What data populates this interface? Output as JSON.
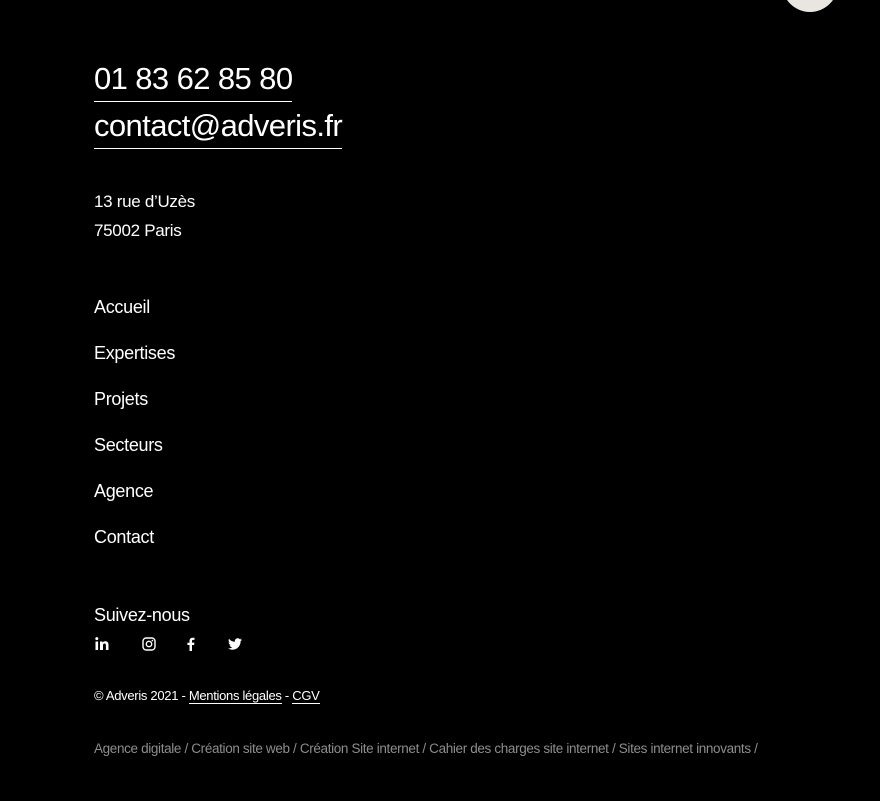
{
  "contact": {
    "phone": "01 83 62 85 80",
    "email": "contact@adveris.fr"
  },
  "address": {
    "line1": "13 rue d’Uzès",
    "line2": "75002 Paris"
  },
  "nav": {
    "items": [
      {
        "label": "Accueil"
      },
      {
        "label": "Expertises"
      },
      {
        "label": "Projets"
      },
      {
        "label": "Secteurs"
      },
      {
        "label": "Agence"
      },
      {
        "label": "Contact"
      }
    ]
  },
  "social": {
    "heading": "Suivez-nous",
    "icons": [
      "linkedin-icon",
      "instagram-icon",
      "facebook-icon",
      "twitter-icon"
    ]
  },
  "legal": {
    "copyright": "© Adveris 2021 - ",
    "mentions": "Mentions légales",
    "separator": " - ",
    "cgv": "CGV"
  },
  "seo_links": [
    {
      "label": "Agence digitale"
    },
    {
      "label": "Création site web"
    },
    {
      "label": "Création Site internet"
    },
    {
      "label": "Cahier des charges site internet"
    },
    {
      "label": "Sites internet innovants"
    }
  ],
  "seo_separator": " / ",
  "colors": {
    "background": "#000000",
    "text": "#ffffff",
    "muted": "#8d8d8d",
    "circle": "#e9e6e2"
  }
}
